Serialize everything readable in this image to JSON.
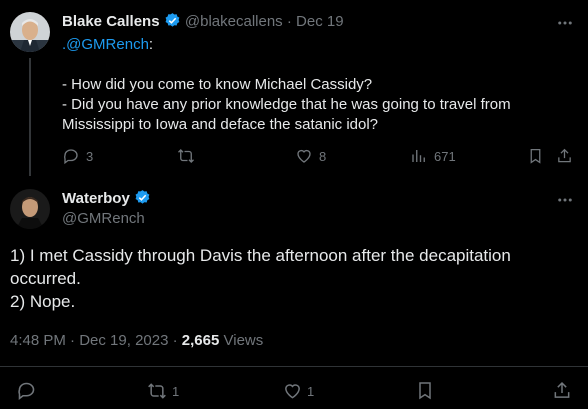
{
  "reply": {
    "author_name": "Blake Callens",
    "handle": "@blakecallens",
    "dot": "·",
    "date": "Dec 19",
    "mention": ".@GMRench",
    "colon": ":",
    "lines": [
      "- How did you come to know Michael Cassidy?",
      "- Did you have any prior knowledge that he was going to travel from",
      "Mississippi to Iowa and deface the satanic idol?"
    ],
    "reply_count": "3",
    "like_count": "8",
    "view_count": "671"
  },
  "main": {
    "author_name": "Waterboy",
    "handle": "@GMRench",
    "lines": [
      "1) I met Cassidy through Davis the afternoon after the decapitation",
      "occurred.",
      "2) Nope."
    ],
    "time": "4:48 PM",
    "dot": "·",
    "date": "Dec 19, 2023",
    "dot2": "·",
    "views": "2,665",
    "views_label": "Views",
    "retweet_count": "1",
    "like_count": "1"
  },
  "icons": [
    "reply-icon",
    "retweet-icon",
    "heart-icon",
    "views-icon",
    "bookmark-icon",
    "share-icon",
    "more-icon",
    "verified-badge-icon"
  ],
  "colors": {
    "background": "#000000",
    "text": "#e7e9ea",
    "muted": "#71767b",
    "link": "#1d9bf0",
    "verified": "#1d9bf0"
  }
}
